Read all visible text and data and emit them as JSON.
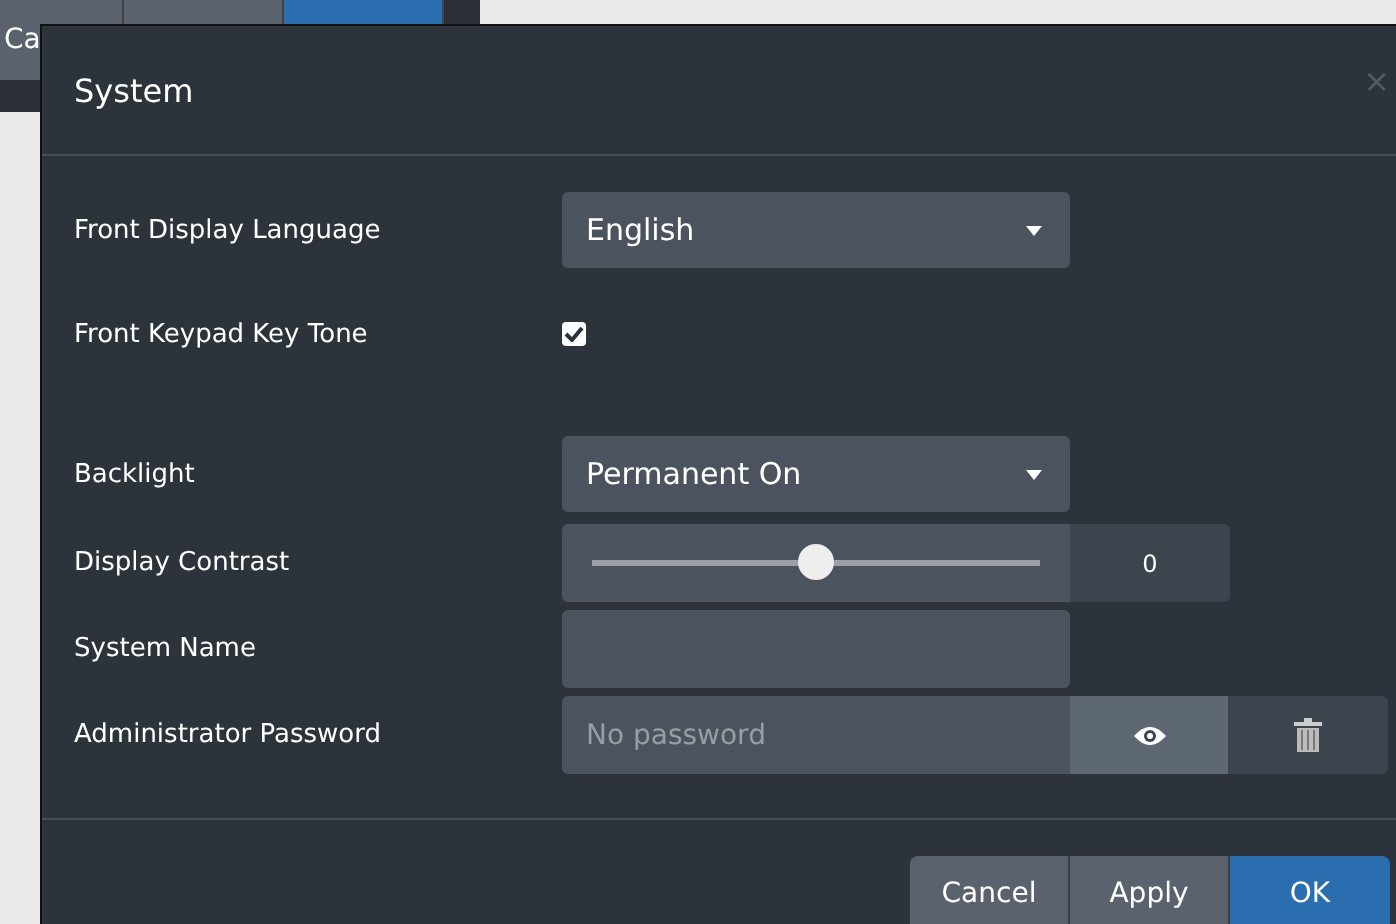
{
  "background_window": {
    "buttons": [
      {
        "label": "Ca",
        "kind": "default"
      },
      {
        "kind": "default"
      },
      {
        "kind": "primary"
      }
    ]
  },
  "window": {
    "title": "System",
    "close": "×"
  },
  "settings": [
    {
      "kind": "dropdown",
      "label": "Front Display Language",
      "value": "English"
    },
    {
      "kind": "checkbox",
      "label": "Front Keypad Key Tone",
      "checked": true
    },
    {
      "kind": "dropdown",
      "label": "Backlight",
      "value": "Permanent On"
    },
    {
      "kind": "slider",
      "label": "Display Contrast",
      "level": 0.5,
      "reading": "0"
    },
    {
      "kind": "text",
      "label": "System Name"
    },
    {
      "kind": "password",
      "label": "Administrator Password",
      "placeholder": "No password"
    }
  ],
  "buttons": [
    {
      "label": "Cancel",
      "kind": "default"
    },
    {
      "label": "Apply",
      "kind": "default"
    },
    {
      "label": "OK",
      "kind": "primary"
    }
  ]
}
